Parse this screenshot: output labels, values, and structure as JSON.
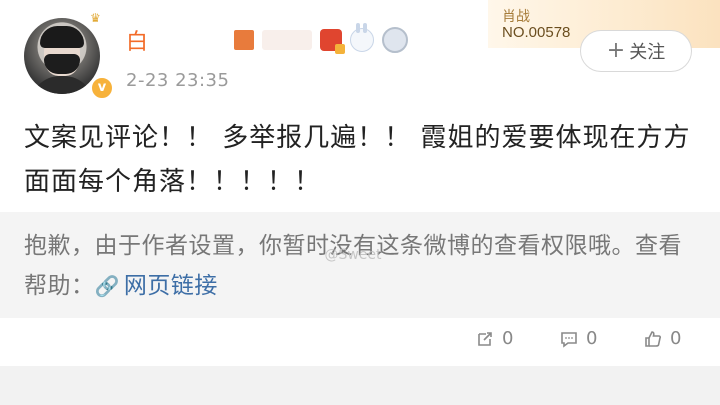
{
  "post": {
    "author_name": "白",
    "time": "2-23 23:35",
    "content": "文案见评论！！ 多举报几遍！！ 霞姐的爱要体现在方方面面每个角落！！！！！",
    "icons": [
      "crown-icon",
      "verified-icon",
      "red-envelope-badge-icon",
      "bunny-badge-icon",
      "medal-badge-icon"
    ]
  },
  "fan_card": {
    "title": "肖战",
    "number": "NO.00578"
  },
  "follow": {
    "plus": "+",
    "label": "关注"
  },
  "notice": {
    "text": "抱歉，由于作者设置，你暂时没有这条微博的查看权限哦。查看帮助：",
    "link_icon": "🔗",
    "link_text": "网页链接"
  },
  "watermark": "@Sweet",
  "actions": {
    "repost_count": "0",
    "comment_count": "0",
    "like_count": "0"
  },
  "colors": {
    "name": "#f36b28",
    "link": "#3d6ea6",
    "verified": "#f7b23b",
    "notice_bg": "#f4f4f4"
  }
}
